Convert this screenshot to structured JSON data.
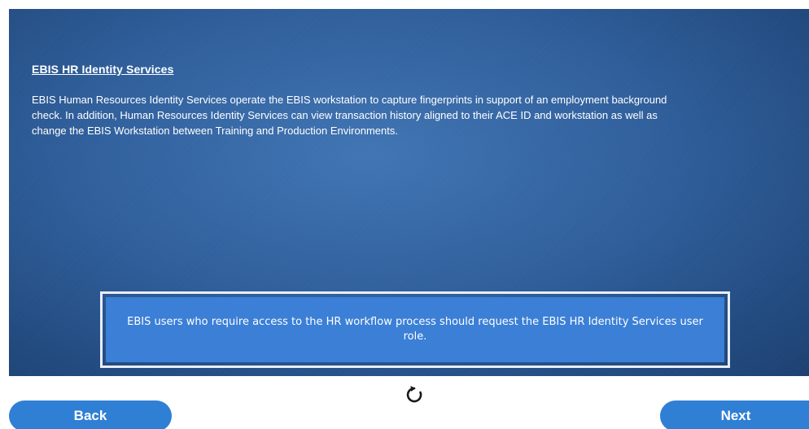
{
  "slide": {
    "heading": "EBIS HR Identity Services",
    "body": "EBIS Human Resources Identity Services operate the EBIS workstation to capture fingerprints in support of an employment background check. In addition, Human Resources Identity Services can view transaction history aligned to their ACE ID and workstation as well as change the EBIS Workstation between Training and Production Environments.",
    "callout": "EBIS users who require access to the HR workflow process should request the EBIS HR Identity Services user role."
  },
  "navigation": {
    "back_label": "Back",
    "next_label": "Next",
    "replay_icon": "replay-icon"
  },
  "colors": {
    "panel": "#2f5f9c",
    "callout": "#3b7fd6",
    "button": "#2f7fd4",
    "text": "#ffffff"
  }
}
